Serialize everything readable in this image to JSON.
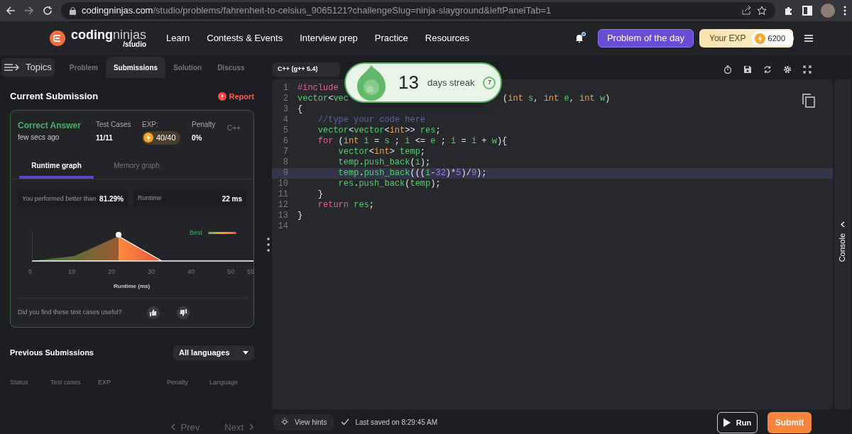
{
  "browser": {
    "url_host": "codingninjas.com",
    "url_path": "/studio/problems/fahrenheit-to-celsius_9065121?challengeSlug=ninja-slayground&leftPanelTab=1"
  },
  "navbar": {
    "logo_word_a": "coding",
    "logo_word_b": "ninjas",
    "logo_sub": "/studio",
    "links": [
      "Learn",
      "Contests & Events",
      "Interview prep",
      "Practice",
      "Resources"
    ],
    "notification_dot": true,
    "problem_of_day": "Problem of the day",
    "exp_label": "Your EXP",
    "exp_value": "6200"
  },
  "left_panel": {
    "topics": "Topics",
    "tabs": [
      {
        "label": "Problem",
        "selected": false
      },
      {
        "label": "Submissions",
        "selected": true
      },
      {
        "label": "Solution",
        "selected": false
      },
      {
        "label": "Discuss",
        "selected": false
      }
    ],
    "current_title": "Current Submission",
    "report": "Report",
    "result": {
      "status": "Correct Answer",
      "time": "few secs ago",
      "test_cases_label": "Test Cases",
      "test_cases": "11/11",
      "exp_label": "EXP:",
      "exp": "40/40",
      "penalty_label": "Penalty",
      "penalty": "0%",
      "language": "C++"
    },
    "graph_tabs": [
      {
        "label": "Runtime graph",
        "selected": true
      },
      {
        "label": "Memory graph",
        "selected": false
      }
    ],
    "better_label": "You performed better than",
    "better_value": "81.29%",
    "runtime_label": "Runtime",
    "runtime_value": "22 ms",
    "graph": {
      "legend": "Best",
      "ticks": [
        "0",
        "10",
        "20",
        "30",
        "40",
        "50",
        "55"
      ],
      "axis_label": "Runtime (ms)"
    },
    "feedback": "Did you find these test cases useful?",
    "previous_title": "Previous Submissions",
    "language_filter": "All languages",
    "columns": [
      "Status",
      "Test cases",
      "EXP",
      "Penalty",
      "Language"
    ],
    "prev": "Prev",
    "next": "Next"
  },
  "editor": {
    "language": "C++ (g++ 5.4)",
    "streak": {
      "count": "13",
      "label": "days streak",
      "badge": "7"
    },
    "lines": [
      {
        "number": "1",
        "highlighted": false,
        "tokens": [
          {
            "kind": "pre",
            "text": "#include"
          },
          {
            "kind": "covered"
          }
        ]
      },
      {
        "number": "2",
        "highlighted": false,
        "tokens": [
          {
            "kind": "id",
            "text": "vector"
          },
          {
            "kind": "p",
            "text": "<"
          },
          {
            "kind": "id",
            "text": "vec"
          },
          {
            "kind": "covered"
          },
          {
            "kind": "p",
            "text": "("
          },
          {
            "kind": "ty",
            "text": "int"
          },
          {
            "kind": "id",
            "text": " s"
          },
          {
            "kind": "p",
            "text": ", "
          },
          {
            "kind": "ty",
            "text": "int"
          },
          {
            "kind": "id",
            "text": " e"
          },
          {
            "kind": "p",
            "text": ", "
          },
          {
            "kind": "ty",
            "text": "int"
          },
          {
            "kind": "id",
            "text": " w"
          },
          {
            "kind": "p",
            "text": ")"
          }
        ]
      },
      {
        "number": "3",
        "highlighted": false,
        "tokens": [
          {
            "kind": "p",
            "text": "{"
          }
        ]
      },
      {
        "number": "4",
        "highlighted": false,
        "tokens": [
          {
            "kind": "cm",
            "text": "    //type your code here"
          }
        ]
      },
      {
        "number": "5",
        "highlighted": false,
        "tokens": [
          {
            "kind": "id",
            "text": "    vector"
          },
          {
            "kind": "p",
            "text": "<"
          },
          {
            "kind": "id",
            "text": "vector"
          },
          {
            "kind": "p",
            "text": "<"
          },
          {
            "kind": "ty",
            "text": "int"
          },
          {
            "kind": "p",
            "text": ">> "
          },
          {
            "kind": "id",
            "text": "res"
          },
          {
            "kind": "p",
            "text": ";"
          }
        ]
      },
      {
        "number": "6",
        "highlighted": false,
        "tokens": [
          {
            "kind": "kw",
            "text": "    for "
          },
          {
            "kind": "p",
            "text": "("
          },
          {
            "kind": "ty",
            "text": "int"
          },
          {
            "kind": "id",
            "text": " i "
          },
          {
            "kind": "p",
            "text": "= "
          },
          {
            "kind": "id",
            "text": "s "
          },
          {
            "kind": "p",
            "text": "; "
          },
          {
            "kind": "id",
            "text": "i "
          },
          {
            "kind": "p",
            "text": "<= "
          },
          {
            "kind": "id",
            "text": "e "
          },
          {
            "kind": "p",
            "text": "; "
          },
          {
            "kind": "id",
            "text": "i "
          },
          {
            "kind": "p",
            "text": "= "
          },
          {
            "kind": "id",
            "text": "i "
          },
          {
            "kind": "p",
            "text": "+ "
          },
          {
            "kind": "id",
            "text": "w"
          },
          {
            "kind": "p",
            "text": "){"
          }
        ]
      },
      {
        "number": "7",
        "highlighted": false,
        "tokens": [
          {
            "kind": "id",
            "text": "        vector"
          },
          {
            "kind": "p",
            "text": "<"
          },
          {
            "kind": "ty",
            "text": "int"
          },
          {
            "kind": "p",
            "text": "> "
          },
          {
            "kind": "id",
            "text": "temp"
          },
          {
            "kind": "p",
            "text": ";"
          }
        ]
      },
      {
        "number": "8",
        "highlighted": false,
        "tokens": [
          {
            "kind": "id",
            "text": "        temp"
          },
          {
            "kind": "p",
            "text": "."
          },
          {
            "kind": "id",
            "text": "push_back"
          },
          {
            "kind": "p",
            "text": "("
          },
          {
            "kind": "id",
            "text": "i"
          },
          {
            "kind": "p",
            "text": ");"
          }
        ]
      },
      {
        "number": "9",
        "highlighted": true,
        "tokens": [
          {
            "kind": "id",
            "text": "        temp"
          },
          {
            "kind": "p",
            "text": "."
          },
          {
            "kind": "id",
            "text": "push_back"
          },
          {
            "kind": "p",
            "text": "((("
          },
          {
            "kind": "id",
            "text": "i"
          },
          {
            "kind": "p",
            "text": "-"
          },
          {
            "kind": "num",
            "text": "32"
          },
          {
            "kind": "p",
            "text": ")*"
          },
          {
            "kind": "num",
            "text": "5"
          },
          {
            "kind": "p",
            "text": ")/"
          },
          {
            "kind": "num",
            "text": "9"
          },
          {
            "kind": "p",
            "text": ");"
          }
        ]
      },
      {
        "number": "10",
        "highlighted": false,
        "tokens": [
          {
            "kind": "id",
            "text": "        res"
          },
          {
            "kind": "p",
            "text": "."
          },
          {
            "kind": "id",
            "text": "push_back"
          },
          {
            "kind": "p",
            "text": "("
          },
          {
            "kind": "id",
            "text": "temp"
          },
          {
            "kind": "p",
            "text": ");"
          }
        ]
      },
      {
        "number": "11",
        "highlighted": false,
        "tokens": [
          {
            "kind": "p",
            "text": "    }"
          }
        ]
      },
      {
        "number": "12",
        "highlighted": false,
        "tokens": [
          {
            "kind": "kw",
            "text": "    return "
          },
          {
            "kind": "id",
            "text": "res"
          },
          {
            "kind": "p",
            "text": ";"
          }
        ]
      },
      {
        "number": "13",
        "highlighted": false,
        "tokens": [
          {
            "kind": "p",
            "text": "}"
          }
        ]
      },
      {
        "number": "14",
        "highlighted": false
      }
    ],
    "view_hints": "View hints",
    "last_saved": "Last saved on 8:29:45 AM",
    "run": "Run",
    "submit": "Submit",
    "console": "Console"
  }
}
